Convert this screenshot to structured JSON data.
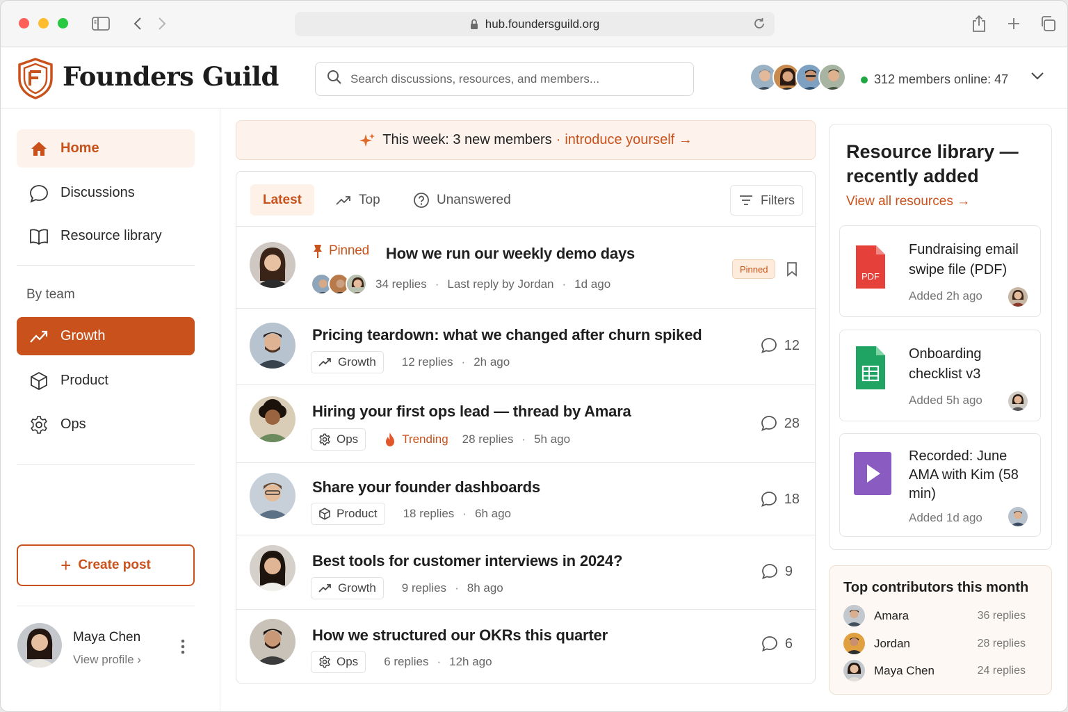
{
  "browser": {
    "url": "hub.foundersguild.org"
  },
  "brand": {
    "name": "Founders Guild",
    "accent": "#c9511b"
  },
  "search": {
    "placeholder": "Search discussions, resources, and members..."
  },
  "header": {
    "online_text": "312 members online: 47"
  },
  "sidebar": {
    "nav": [
      {
        "label": "Home",
        "icon": "home-icon"
      },
      {
        "label": "Discussions",
        "icon": "chat-bubble-icon"
      },
      {
        "label": "Resource library",
        "icon": "book-icon"
      }
    ],
    "section_label": "By team",
    "teams": [
      {
        "label": "Growth",
        "icon": "trend-up-icon",
        "active": true
      },
      {
        "label": "Product",
        "icon": "cube-icon"
      },
      {
        "label": "Ops",
        "icon": "gear-icon"
      }
    ],
    "create_label": "Create post",
    "profile": {
      "name": "Maya Chen",
      "link": "View profile ›"
    }
  },
  "banner": {
    "text": "This week: 3 new members",
    "sep": "·",
    "cta": "introduce yourself →"
  },
  "feed": {
    "tabs": [
      {
        "label": "Latest",
        "active": true
      },
      {
        "label": "Top",
        "icon": "trend-up-icon"
      },
      {
        "label": "Unanswered",
        "icon": "question-circle-icon"
      }
    ],
    "filters_label": "Filters",
    "posts": [
      {
        "pinned_label": "Pinned",
        "title": "How we run our weekly demo days",
        "replies": "34 replies",
        "last_reply": "Last reply by Jordan",
        "time": "1d ago",
        "badge": "Pinned"
      },
      {
        "title": "Pricing teardown: what we changed after churn spiked",
        "tag": "Growth",
        "replies": "12 replies",
        "time": "2h ago",
        "count": "12"
      },
      {
        "title": "Hiring your first ops lead — thread by Amara",
        "tag": "Ops",
        "trending": "Trending",
        "replies": "28 replies",
        "time": "5h ago",
        "count": "28"
      },
      {
        "title": "Share your founder dashboards",
        "tag": "Product",
        "replies": "18 replies",
        "time": "6h ago",
        "count": "18"
      },
      {
        "title": "Best tools for customer interviews in 2024?",
        "tag": "Growth",
        "replies": "9 replies",
        "time": "8h ago",
        "count": "9"
      },
      {
        "title": "How we structured our OKRs this quarter",
        "tag": "Ops",
        "replies": "6 replies",
        "time": "12h ago",
        "count": "6"
      }
    ]
  },
  "resources": {
    "title": "Resource library — recently added",
    "view_all": "View all resources →",
    "items": [
      {
        "title": "Fundraising email swipe file (PDF)",
        "added": "Added 2h ago",
        "icon": "pdf-file-icon",
        "icon_text": "PDF"
      },
      {
        "title": "Onboarding checklist v3",
        "added": "Added 5h ago",
        "icon": "spreadsheet-icon"
      },
      {
        "title": "Recorded: June AMA with Kim (58 min)",
        "added": "Added 1d ago",
        "icon": "video-play-icon"
      }
    ]
  },
  "contributors": {
    "title": "Top contributors this month",
    "rows": [
      {
        "name": "Amara",
        "replies": "36 replies"
      },
      {
        "name": "Jordan",
        "replies": "28 replies"
      },
      {
        "name": "Maya Chen",
        "replies": "24 replies"
      }
    ]
  }
}
